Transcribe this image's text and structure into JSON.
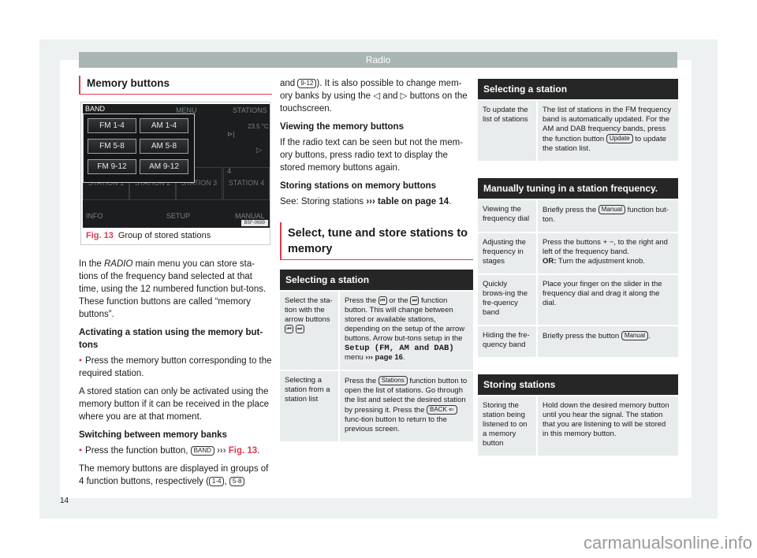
{
  "header": {
    "title": "Radio"
  },
  "page_number": "14",
  "watermark": "carmanualsonline.info",
  "col1": {
    "section_title": "Memory buttons",
    "figure": {
      "screen": {
        "top_tabs": [
          "BAND",
          "MENU",
          "STATIONS"
        ],
        "temperature": "23.5 °C",
        "band_buttons": [
          "FM 1-4",
          "AM 1-4",
          "FM 5-8",
          "AM 5-8",
          "FM 9-12",
          "AM 9-12"
        ],
        "stations": [
          "STATION 1",
          "STATION 2",
          "STATION 3",
          "STATION 4"
        ],
        "station4_number": "4",
        "bottom_tabs": [
          "INFO",
          "SETUP",
          "MANUAL"
        ],
        "code": "B5F-0689"
      },
      "caption_label": "Fig. 13",
      "caption_text": "Group of stored stations"
    },
    "intro_pre": "In the ",
    "intro_italic": "RADIO",
    "intro_post": " main menu you can store sta-tions of the frequency band selected at that time, using the 12 numbered function but-tons. These function buttons are called “memory buttons”.",
    "h_activating": "Activating a station using the memory but-tons",
    "activating_bullet": "Press the memory button corresponding to the required station.",
    "stored_note": "A stored station can only be activated using the memory button if it can be received in the place where you are at that moment.",
    "h_switching": "Switching between memory banks",
    "switching_bullet_pre": "Press the function button, ",
    "switching_key": "BAND",
    "switching_ref": "›››",
    "switching_fig": "Fig. 13",
    "groups_text": "The memory buttons are displayed in groups of 4 function buttons, respectively (",
    "group_keys": [
      "1-4",
      "5-8"
    ]
  },
  "col2": {
    "cont_pre": "and ",
    "cont_key": "9-12",
    "cont_post": "). It is also possible to change mem-ory banks by using the ◁ and ▷ buttons on the touchscreen.",
    "h_viewing": "Viewing the memory buttons",
    "viewing_text": "If the radio text can be seen but not the mem-ory buttons, press radio text to display the stored memory buttons again.",
    "h_storing": "Storing stations on memory buttons",
    "storing_pre": "See: Storing stations ",
    "storing_ref": "››› table on page 14",
    "section_title": "Select, tune and store stations to memory",
    "table": {
      "title": "Selecting a station",
      "rows": [
        {
          "c1": "Select the sta-tion with the arrow buttons",
          "c2_a": "Press the ",
          "c2_b": " or the ",
          "c2_c": " function button. This will change between stored or available stations, depending on the setup of the arrow buttons. Arrow but-tons setup in the ",
          "c2_mono": "Setup (FM, AM and DAB)",
          "c2_d": " menu ",
          "c2_ref": "››› page 16",
          "c2_e": "."
        },
        {
          "c1": "Selecting a station from a station list",
          "c2_a": "Press the ",
          "c2_key1": "Stations",
          "c2_b": " function button to open the list of stations. Go through the list and select the desired station by pressing it. Press the ",
          "c2_key2": "BACK ⇐",
          "c2_c": " func-tion button to return to the previous screen."
        }
      ]
    }
  },
  "col3": {
    "table1": {
      "title": "Selecting a station",
      "rows": [
        {
          "c1": "To update the list of stations",
          "c2_a": "The list of stations in the FM frequency band is automatically updated. For the AM and DAB frequency bands, press the function button ",
          "c2_key": "Update",
          "c2_b": " to update the station list."
        }
      ]
    },
    "table2": {
      "title": "Manually tuning in a station frequency.",
      "rows": [
        {
          "c1": "Viewing the frequency dial",
          "c2_a": "Briefly press the ",
          "c2_key": "Manual",
          "c2_b": " function but-ton."
        },
        {
          "c1": "Adjusting the frequency in stages",
          "c2_a": "Press the buttons + −, to the right and left of the frequency band.",
          "c2_bold": "OR:",
          "c2_b": " Turn the adjustment knob."
        },
        {
          "c1": "Quickly brows-ing the fre-quency band",
          "c2_a": "Place your finger on the slider in the frequency dial and drag it along the dial."
        },
        {
          "c1": "Hiding the fre-quency band",
          "c2_a": "Briefly press the button ",
          "c2_key": "Manual",
          "c2_b": "."
        }
      ]
    },
    "table3": {
      "title": "Storing stations",
      "rows": [
        {
          "c1": "Storing the station being listened to on a memory button",
          "c2_a": "Hold down the desired memory button until you hear the signal. The station that you are listening to will be stored in this memory button."
        }
      ]
    }
  },
  "colors": {
    "accent": "#e0384f",
    "header_bar": "#a9b5b3",
    "table_header": "#262626",
    "table_cell": "#e9eced"
  }
}
